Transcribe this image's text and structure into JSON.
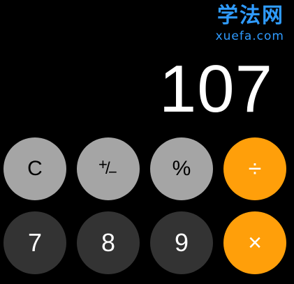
{
  "watermark": {
    "chinese": "学法网",
    "site": "xuefa.com",
    "color": "#2f9bff"
  },
  "display": {
    "value": "107"
  },
  "keys": {
    "clear": "C",
    "sign_plus": "+",
    "sign_slash": "/",
    "sign_minus": "−",
    "percent": "%",
    "divide": "÷",
    "seven": "7",
    "eight": "8",
    "nine": "9",
    "multiply": "×"
  },
  "colors": {
    "background": "#000000",
    "function_key": "#a5a5a5",
    "number_key": "#333333",
    "operator_key": "#ff9f0a"
  }
}
